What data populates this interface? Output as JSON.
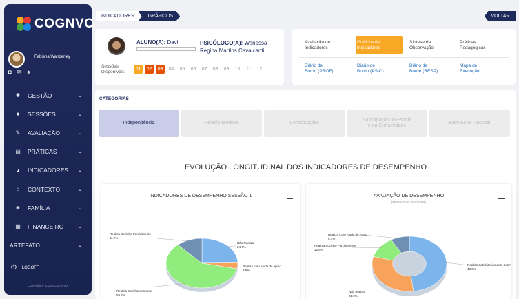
{
  "brand": {
    "name": "COGNVOX"
  },
  "profile": {
    "name": "Fabiana Wanderley"
  },
  "sidebar": {
    "items": [
      {
        "label": "GESTÃO",
        "icon": "gear-icon",
        "glyph": "✱"
      },
      {
        "label": "SESSÕES",
        "icon": "video-icon",
        "glyph": "■"
      },
      {
        "label": "AVALIAÇÃO",
        "icon": "edit-icon",
        "glyph": "✎"
      },
      {
        "label": "PRÁTICAS",
        "icon": "card-icon",
        "glyph": "▤"
      },
      {
        "label": "INDICADORES",
        "icon": "pie-icon",
        "glyph": "◕"
      },
      {
        "label": "CONTEXTO",
        "icon": "home-icon",
        "glyph": "⌂"
      },
      {
        "label": "FAMÍLIA",
        "icon": "users-icon",
        "glyph": "☻"
      },
      {
        "label": "FINANCEIRO",
        "icon": "calculator-icon",
        "glyph": "▦"
      }
    ],
    "artefato": "ARTEFATO",
    "logout": "LOGOFF",
    "copyright": "Copyright © 2020 COGNVOX"
  },
  "breadcrumb": {
    "first": "INDICADORES",
    "second": "GRÁFICOS"
  },
  "voltar": "VOLTAR",
  "student": {
    "aluno_label": "ALUNO(A):",
    "aluno_name": "Davi",
    "psico_label": "PSICÓLOGO(A):",
    "psico_name_1": "Wanessa",
    "psico_name_2": "Regina Martins Cavalcanti",
    "sessions_label_1": "Sessões",
    "sessions_label_2": "Disponíveis:",
    "sessions": [
      "01",
      "02",
      "03",
      "04",
      "05",
      "06",
      "07",
      "08",
      "09",
      "10",
      "11",
      "12"
    ]
  },
  "nav": {
    "row1": [
      {
        "l1": "Avaliação de",
        "l2": "Indicadores"
      },
      {
        "l1": "Gráficos de",
        "l2": "Indicadores"
      },
      {
        "l1": "Síntese da",
        "l2": "Observação"
      },
      {
        "l1": "Práticas",
        "l2": "Pedagógicas"
      }
    ],
    "row2": [
      {
        "l1": "Diário de",
        "l2": "Bordo (PROF)"
      },
      {
        "l1": "Diário de",
        "l2": "Bordo (PSIC)"
      },
      {
        "l1": "Diário de",
        "l2": "Bordo (RESP)"
      },
      {
        "l1": "Mapa de",
        "l2": "Execução"
      }
    ]
  },
  "categorias": {
    "title": "CATEGORIAS",
    "tabs": [
      {
        "l1": "Independência",
        "l2": ""
      },
      {
        "l1": "Relacionamento",
        "l2": ""
      },
      {
        "l1": "Contribuições",
        "l2": ""
      },
      {
        "l1": "Participação na Escola",
        "l2": "e na Comunidade"
      },
      {
        "l1": "Bem-Estar Pessoal",
        "l2": ""
      }
    ]
  },
  "evolution_title": "EVOLUÇÃO LONGITUDINAL DOS INDICADORES DE DESEMPENHO",
  "colors": {
    "blue": "#7cb5ec",
    "green": "#90ed7d",
    "orange": "#f7a35c",
    "slate": "#6f8fb3",
    "navy": "#1f2a5c",
    "accent": "#f9a825"
  },
  "chart_data": [
    {
      "type": "pie",
      "title": "INDICADORES DE DESEMPENHO SESSÃO 1",
      "subtitle": "",
      "slices": [
        {
          "label": "Não Realiza",
          "value": 24.7,
          "value_text": "24.7%",
          "color": "#7cb5ec"
        },
        {
          "label": "Realiza com Ajuda de apoio",
          "value": 3.9,
          "value_text": "3.9%",
          "color": "#f7a35c"
        },
        {
          "label": "Realiza Satisfatoriamente",
          "value": 59.7,
          "value_text": "59.7%",
          "color": "#90ed7d"
        },
        {
          "label": "Realiza Sozinho Parcialmente",
          "value": 11.7,
          "value_text": "11.7%",
          "color": "#6f8fb3"
        }
      ]
    },
    {
      "type": "pie",
      "title": "AVALIAÇÃO DE DESEMPENHO",
      "subtitle": "(MÉDIA DAS SESSÕES)",
      "slices": [
        {
          "label": "Realiza Satisfatoriamente Sozinho",
          "value": 48.3,
          "value_text": "48.3%",
          "color": "#7cb5ec"
        },
        {
          "label": "Não realiza",
          "value": 31.0,
          "value_text": "31.0%",
          "color": "#f7a35c"
        },
        {
          "label": "Realiza Sozinho Parcialmente",
          "value": 12.6,
          "value_text": "12.6%",
          "color": "#90ed7d"
        },
        {
          "label": "Realiza Com Ajuda de Apoio",
          "value": 8.1,
          "value_text": "8.1%",
          "color": "#6f8fb3"
        }
      ]
    }
  ]
}
